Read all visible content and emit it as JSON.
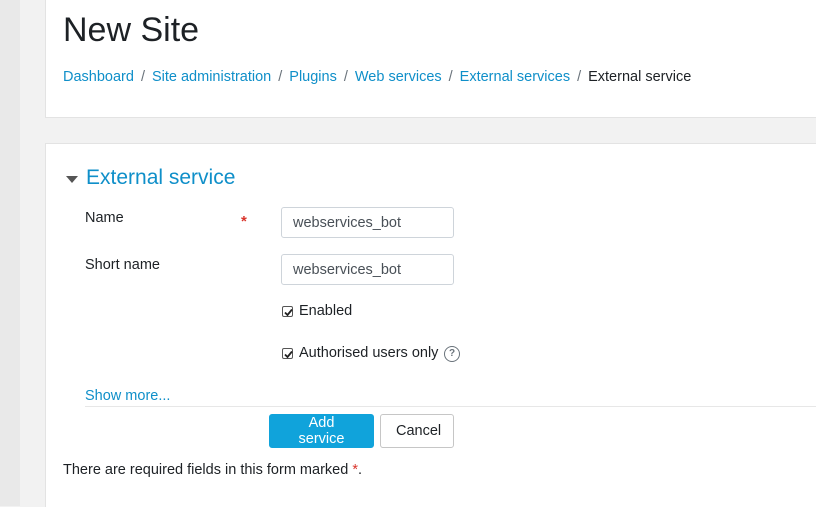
{
  "page": {
    "title": "New Site"
  },
  "breadcrumb": {
    "links": [
      "Dashboard",
      "Site administration",
      "Plugins",
      "Web services",
      "External services"
    ],
    "separator": "/",
    "current": "External service"
  },
  "form": {
    "legend": "External service",
    "required_marker": "*",
    "fields": {
      "name": {
        "label": "Name",
        "value": "webservices_bot"
      },
      "shortname": {
        "label": "Short name",
        "value": "webservices_bot"
      }
    },
    "checkboxes": {
      "enabled": {
        "label": "Enabled",
        "checked": true
      },
      "restricted": {
        "label": "Authorised users only",
        "checked": true
      }
    },
    "help_icon": "?",
    "show_more": "Show more...",
    "buttons": {
      "submit": "Add service",
      "cancel": "Cancel"
    },
    "required_note": {
      "text": "There are required fields in this form marked ",
      "star": "*",
      "end": "."
    }
  },
  "colors": {
    "link": "#0f8fc9",
    "primary": "#10a3db",
    "required": "#d9342b"
  }
}
